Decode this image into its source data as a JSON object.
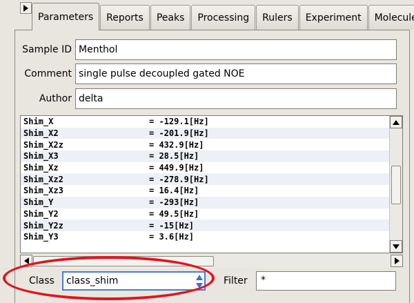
{
  "tabs": [
    {
      "label": "Parameters",
      "active": true
    },
    {
      "label": "Reports",
      "active": false
    },
    {
      "label": "Peaks",
      "active": false
    },
    {
      "label": "Processing",
      "active": false
    },
    {
      "label": "Rulers",
      "active": false
    },
    {
      "label": "Experiment",
      "active": false
    },
    {
      "label": "Molecules",
      "active": false
    }
  ],
  "form": {
    "sample_id": {
      "label": "Sample ID",
      "value": "Menthol"
    },
    "comment": {
      "label": "Comment",
      "value": "single pulse decoupled gated NOE"
    },
    "author": {
      "label": "Author",
      "value": "delta"
    }
  },
  "parameters": [
    {
      "name": "Shim_X",
      "value": "= -129.1[Hz]"
    },
    {
      "name": "Shim_X2",
      "value": "= -201.9[Hz]"
    },
    {
      "name": "Shim_X2z",
      "value": "= 432.9[Hz]"
    },
    {
      "name": "Shim_X3",
      "value": "= 28.5[Hz]"
    },
    {
      "name": "Shim_Xz",
      "value": "= 449.9[Hz]"
    },
    {
      "name": "Shim_Xz2",
      "value": "= -278.9[Hz]"
    },
    {
      "name": "Shim_Xz3",
      "value": "= 16.4[Hz]"
    },
    {
      "name": "Shim_Y",
      "value": "= -293[Hz]"
    },
    {
      "name": "Shim_Y2",
      "value": "= 49.5[Hz]"
    },
    {
      "name": "Shim_Y2z",
      "value": "= -15[Hz]"
    },
    {
      "name": "Shim_Y3",
      "value": "= 3.6[Hz]"
    }
  ],
  "bottom": {
    "class_label": "Class",
    "class_value": "class_shim",
    "filter_label": "Filter",
    "filter_value": "*"
  },
  "colors": {
    "highlight": "#e2141d",
    "focus": "#4a7bd1"
  }
}
